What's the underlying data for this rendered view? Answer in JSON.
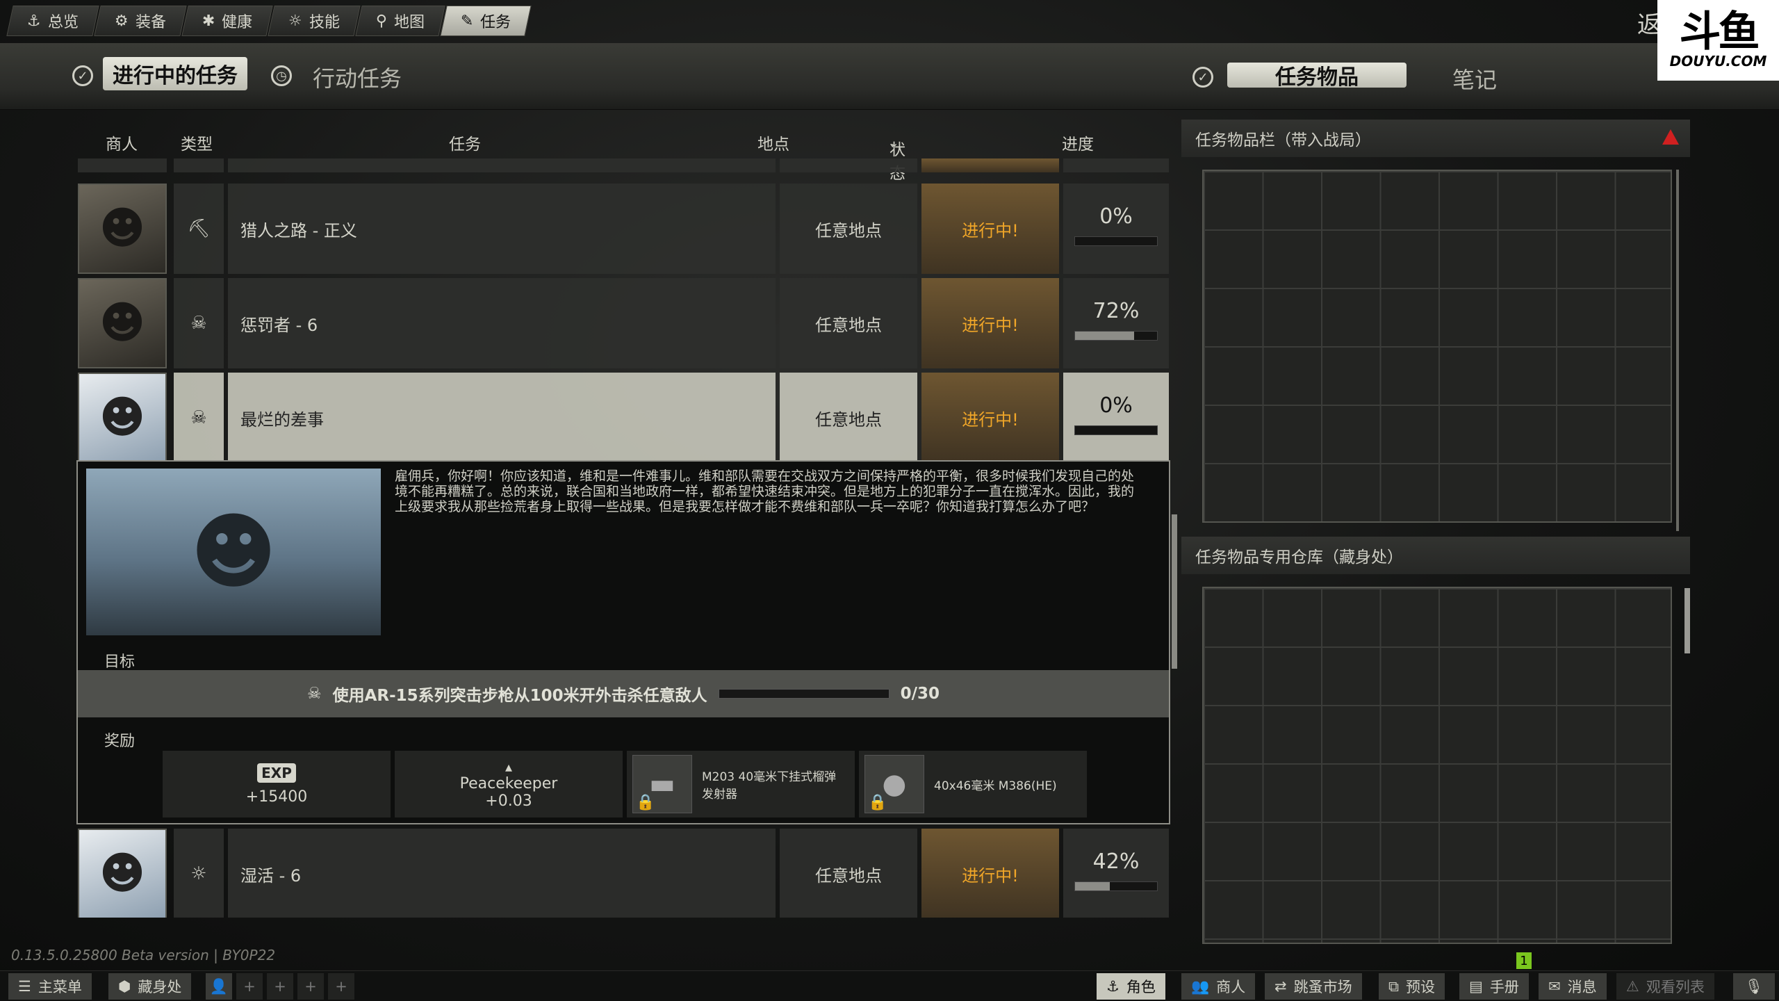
{
  "top_tabs": [
    {
      "icon": "⚓",
      "label": "总览"
    },
    {
      "icon": "⚙",
      "label": "装备"
    },
    {
      "icon": "✱",
      "label": "健康"
    },
    {
      "icon": "☼",
      "label": "技能"
    },
    {
      "icon": "⚲",
      "label": "地图"
    },
    {
      "icon": "✎",
      "label": "任务"
    }
  ],
  "header": {
    "back_label": "返",
    "active_quests_label": "进行中的任务",
    "operation_quests_label": "行动任务",
    "quest_items_label": "任务物品",
    "notes_label": "笔记"
  },
  "watermark": {
    "main": "斗鱼",
    "sub": "DOUYU.COM"
  },
  "table": {
    "columns": {
      "trader": "商人",
      "type": "类型",
      "task": "任务",
      "location": "地点",
      "status": "状态",
      "progress": "进度"
    },
    "rows": [
      {
        "name": "猎人之路 - 正义",
        "type_icon": "⛏",
        "location": "任意地点",
        "status": "进行中!",
        "progress_text": "0%",
        "progress": 0
      },
      {
        "name": "惩罚者 - 6",
        "type_icon": "☠",
        "location": "任意地点",
        "status": "进行中!",
        "progress_text": "72%",
        "progress": 0.72
      },
      {
        "name": "最烂的差事",
        "type_icon": "☠",
        "location": "任意地点",
        "status": "进行中!",
        "progress_text": "0%",
        "progress": 0
      },
      {
        "name": "湿活 - 6",
        "type_icon": "☼",
        "location": "任意地点",
        "status": "进行中!",
        "progress_text": "42%",
        "progress": 0.42
      }
    ]
  },
  "detail": {
    "description": "雇佣兵，你好啊！你应该知道，维和是一件难事儿。维和部队需要在交战双方之间保持严格的平衡，很多时候我们发现自己的处境不能再糟糕了。总的来说，联合国和当地政府一样，都希望快速结束冲突。但是地方上的犯罪分子一直在搅浑水。因此，我的上级要求我从那些捡荒者身上取得一些战果。但是我要怎样做才能不费维和部队一兵一卒呢？你知道我打算怎么办了吧？",
    "objective_label": "目标",
    "objective_text": "使用AR-15系列突击步枪从100米开外击杀任意敌人",
    "objective_count": "0/30",
    "rewards_label": "奖励",
    "rewards": {
      "exp_badge": "EXP",
      "exp_value": "+15400",
      "rep_trader": "Peacekeeper",
      "rep_value": "+0.03",
      "item1": "M203 40毫米下挂式榴弹发射器",
      "item2": "40x46毫米 M386(HE)"
    }
  },
  "right": {
    "stash_title": "任务物品栏（带入战局）",
    "storage_title": "任务物品专用仓库（藏身处）"
  },
  "version": "0.13.5.0.25800 Beta version | BY0P22",
  "badge_count": "1",
  "bottom": {
    "main_menu": "主菜单",
    "hideout": "藏身处",
    "character": "角色",
    "traders": "商人",
    "flea": "跳蚤市场",
    "presets": "预设",
    "handbook": "手册",
    "messages": "消息",
    "watchlist": "观看列表"
  }
}
